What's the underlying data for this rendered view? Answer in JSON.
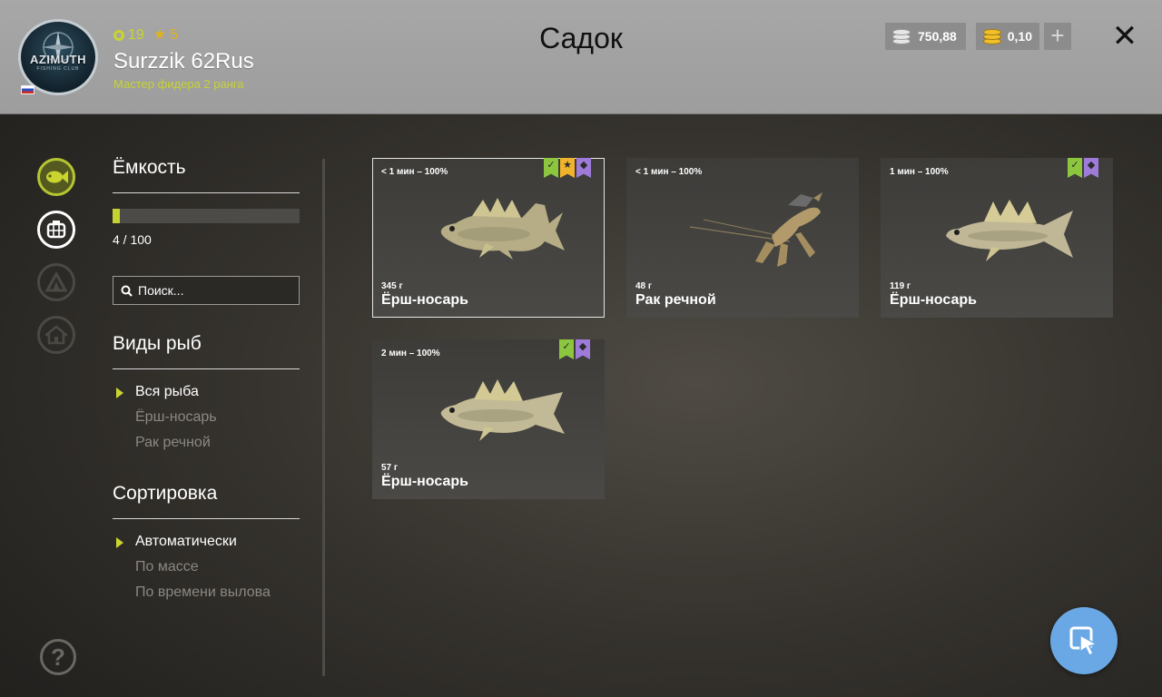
{
  "header": {
    "title": "Садок",
    "avatar": {
      "logo_text": "AZIMUTH",
      "logo_sub": "FISHING CLUB"
    },
    "level": "19",
    "stars": "5",
    "player_name": "Surzzik 62Rus",
    "player_rank": "Мастер фидера 2 ранга",
    "silver": "750,88",
    "gold": "0,10",
    "add_label": "+",
    "close_label": "✕"
  },
  "rail": {
    "items": [
      {
        "name": "fish",
        "icon": "fish-icon",
        "active": true
      },
      {
        "name": "keepnet",
        "icon": "keepnet-icon",
        "active": false
      },
      {
        "name": "tent",
        "icon": "tent-icon",
        "active": false
      },
      {
        "name": "home",
        "icon": "home-icon",
        "active": false
      }
    ],
    "help_label": "?"
  },
  "capacity": {
    "title": "Ёмкость",
    "used": 4,
    "total": 100,
    "label": "4 / 100"
  },
  "search": {
    "placeholder": "Поиск..."
  },
  "species": {
    "title": "Виды рыб",
    "options": [
      "Вся рыба",
      "Ёрш-носарь",
      "Рак речной"
    ],
    "selected": 0
  },
  "sort": {
    "title": "Сортировка",
    "options": [
      "Автоматически",
      "По массе",
      "По времени вылова"
    ],
    "selected": 0
  },
  "catches": [
    {
      "time": "< 1 мин – 100%",
      "weight": "345 г",
      "name": "Ёрш-носарь",
      "badges": [
        "green",
        "yellow",
        "purple"
      ],
      "kind": "fish",
      "selected": true
    },
    {
      "time": "< 1 мин – 100%",
      "weight": "48 г",
      "name": "Рак речной",
      "badges": [],
      "kind": "crayfish",
      "selected": false
    },
    {
      "time": "1 мин – 100%",
      "weight": "119 г",
      "name": "Ёрш-носарь",
      "badges": [
        "green",
        "purple"
      ],
      "kind": "fish",
      "selected": false
    },
    {
      "time": "2 мин – 100%",
      "weight": "57 г",
      "name": "Ёрш-носарь",
      "badges": [
        "green",
        "purple"
      ],
      "kind": "fish",
      "selected": false
    }
  ],
  "colors": {
    "accent": "#c9d42f",
    "badge_green": "#8cc63f",
    "badge_yellow": "#f0b32c",
    "badge_purple": "#9e7bd9",
    "fab": "#6aa8e5"
  }
}
